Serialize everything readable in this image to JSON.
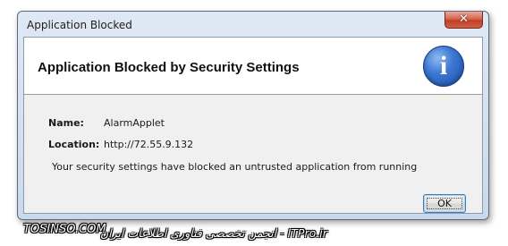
{
  "window": {
    "title": "Application Blocked",
    "close_glyph": "✕"
  },
  "header": {
    "title": "Application Blocked by Security Settings",
    "icon": "info-icon",
    "icon_glyph": "i",
    "icon_color": "#2f6fcf"
  },
  "details": {
    "name_label": "Name:",
    "name_value": "AlarmApplet",
    "location_label": "Location:",
    "location_value": "http://72.55.9.132",
    "message": "Your security settings have blocked an untrusted application from running"
  },
  "buttons": {
    "ok_label": "OK"
  },
  "watermark": {
    "left_text": "TOSINSO.COM",
    "right_text": "انجمن تخصصی فناوری اطلاعات ایران - ITPro.ir"
  },
  "colors": {
    "close_button": "#c9422b",
    "ok_button_border": "#3c7fb1"
  }
}
